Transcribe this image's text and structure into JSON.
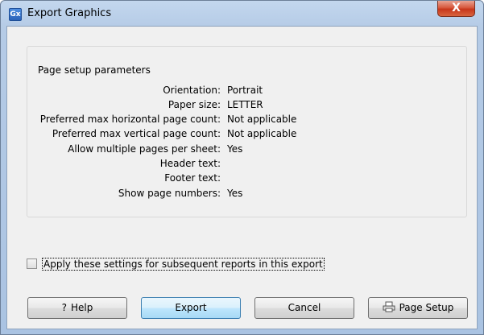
{
  "window": {
    "title": "Export Graphics",
    "app_icon_text": "Gx",
    "close_glyph": "X"
  },
  "group": {
    "title": "Page setup parameters",
    "rows": [
      {
        "label": "Orientation:",
        "value": "Portrait"
      },
      {
        "label": "Paper size:",
        "value": "LETTER"
      },
      {
        "label": "Preferred max horizontal page count:",
        "value": "Not applicable"
      },
      {
        "label": "Preferred max vertical page count:",
        "value": "Not applicable"
      },
      {
        "label": "Allow multiple pages per sheet:",
        "value": "Yes"
      },
      {
        "label": "Header text:",
        "value": ""
      },
      {
        "label": "Footer text:",
        "value": ""
      },
      {
        "label": "Show page numbers:",
        "value": "Yes"
      }
    ]
  },
  "checkbox": {
    "label": "Apply these settings for subsequent reports in this export",
    "checked": false
  },
  "buttons": {
    "help": {
      "label": "Help",
      "icon": "question-icon",
      "glyph": "?"
    },
    "export": {
      "label": "Export"
    },
    "cancel": {
      "label": "Cancel"
    },
    "page_setup": {
      "label": "Page Setup",
      "icon": "printer-icon"
    }
  }
}
